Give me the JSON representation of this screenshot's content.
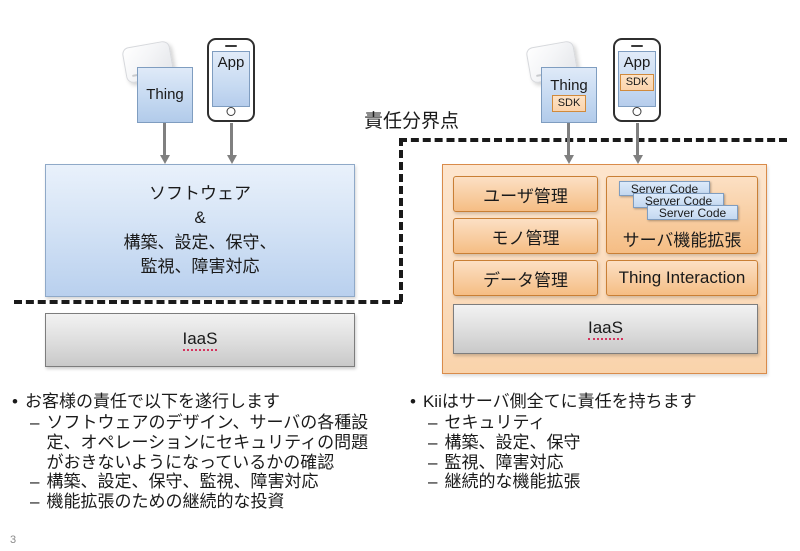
{
  "slide": {
    "page_number": "3",
    "boundary_label": "責任分界点"
  },
  "left_diagram": {
    "thing": {
      "label": "Thing",
      "icon": "router-icon"
    },
    "app": {
      "label": "App",
      "icon": "smartphone-icon"
    },
    "software_box": {
      "line1": "ソフトウェア",
      "line2": "&",
      "line3": "構築、設定、保守、",
      "line4": "監視、障害対応"
    },
    "iaas_label": "IaaS"
  },
  "right_diagram": {
    "thing": {
      "label": "Thing",
      "badge": "SDK",
      "icon": "router-icon"
    },
    "app": {
      "label": "App",
      "badge": "SDK",
      "icon": "smartphone-icon"
    },
    "features": {
      "user_management": "ユーザ管理",
      "thing_management": "モノ管理",
      "data_management": "データ管理",
      "server_extension": "サーバ機能拡張",
      "thing_interaction": "Thing Interaction"
    },
    "server_code_cards": [
      "Server Code",
      "Server Code",
      "Server Code"
    ],
    "iaas_label": "IaaS"
  },
  "left_notes": {
    "heading_marker": "•",
    "heading": "お客様の責任で以下を遂行します",
    "sub_marker": "–",
    "items": [
      "ソフトウェアのデザイン、サーバの各種設定、オペレーションにセキュリティの問題がおきないようになっているかの確認",
      "構築、設定、保守、監視、障害対応",
      "機能拡張のための継続的な投資"
    ]
  },
  "right_notes": {
    "heading_marker": "•",
    "heading": "Kiiはサーバ側全てに責任を持ちます",
    "sub_marker": "–",
    "items": [
      "セキュリティ",
      "構築、設定、保守",
      "監視、障害対応",
      "継続的な機能拡張"
    ]
  },
  "colors": {
    "blue_fill": "#c5d9f1",
    "orange_fill": "#f8cda1",
    "gray_fill": "#e2e2e2",
    "boundary": "#1a1a1a"
  }
}
